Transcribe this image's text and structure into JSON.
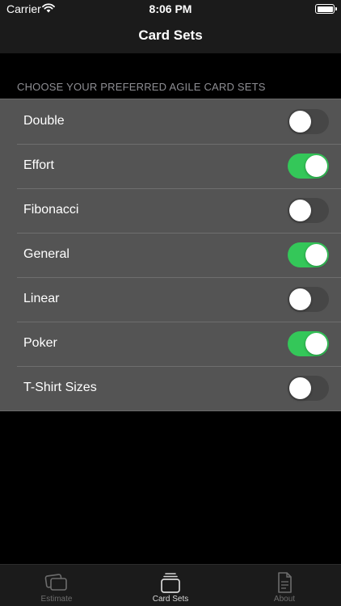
{
  "status_bar": {
    "carrier": "Carrier",
    "time": "8:06 PM"
  },
  "nav": {
    "title": "Card Sets"
  },
  "section": {
    "header": "CHOOSE YOUR PREFERRED AGILE CARD SETS"
  },
  "card_sets": [
    {
      "label": "Double",
      "enabled": false
    },
    {
      "label": "Effort",
      "enabled": true
    },
    {
      "label": "Fibonacci",
      "enabled": false
    },
    {
      "label": "General",
      "enabled": true
    },
    {
      "label": "Linear",
      "enabled": false
    },
    {
      "label": "Poker",
      "enabled": true
    },
    {
      "label": "T-Shirt Sizes",
      "enabled": false
    }
  ],
  "tabs": [
    {
      "label": "Estimate",
      "icon": "cards-icon",
      "active": false
    },
    {
      "label": "Card Sets",
      "icon": "card-stack-icon",
      "active": true
    },
    {
      "label": "About",
      "icon": "document-icon",
      "active": false
    }
  ],
  "colors": {
    "toggle_on": "#34c759",
    "toggle_off": "#464646",
    "list_background": "#545454"
  }
}
